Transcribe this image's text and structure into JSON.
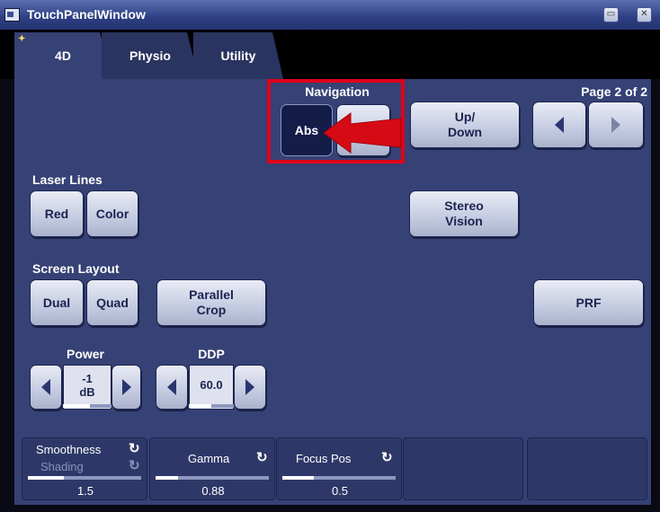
{
  "window": {
    "title": "TouchPanelWindow",
    "minimize_label": "▭",
    "close_label": "✕"
  },
  "tabs": [
    {
      "label": "4D",
      "active": true
    },
    {
      "label": "Physio",
      "active": false
    },
    {
      "label": "Utility",
      "active": false
    }
  ],
  "navigation": {
    "label": "Navigation",
    "abs_label": "Abs",
    "second_label": ""
  },
  "updown": {
    "label": "Up/\nDown"
  },
  "page": {
    "label": "Page 2 of 2"
  },
  "laser_lines": {
    "label": "Laser Lines",
    "red_label": "Red",
    "color_label": "Color"
  },
  "stereo": {
    "label": "Stereo\nVision"
  },
  "screen_layout": {
    "label": "Screen Layout",
    "dual_label": "Dual",
    "quad_label": "Quad"
  },
  "parallel_crop": {
    "label": "Parallel\nCrop"
  },
  "prf": {
    "label": "PRF"
  },
  "power": {
    "label": "Power",
    "value": "-1\ndB",
    "level": 0.55
  },
  "ddp": {
    "label": "DDP",
    "value": "60.0",
    "level": 0.5
  },
  "sliders": [
    {
      "name": "Smoothness",
      "sub": "Shading",
      "value": "1.5",
      "level": 0.32
    },
    {
      "name": "Gamma",
      "value": "0.88",
      "level": 0.2
    },
    {
      "name": "Focus Pos",
      "value": "0.5",
      "level": 0.28
    }
  ],
  "colors": {
    "panel": "#364175",
    "highlight": "#e0001a",
    "selected": "#141c48"
  }
}
